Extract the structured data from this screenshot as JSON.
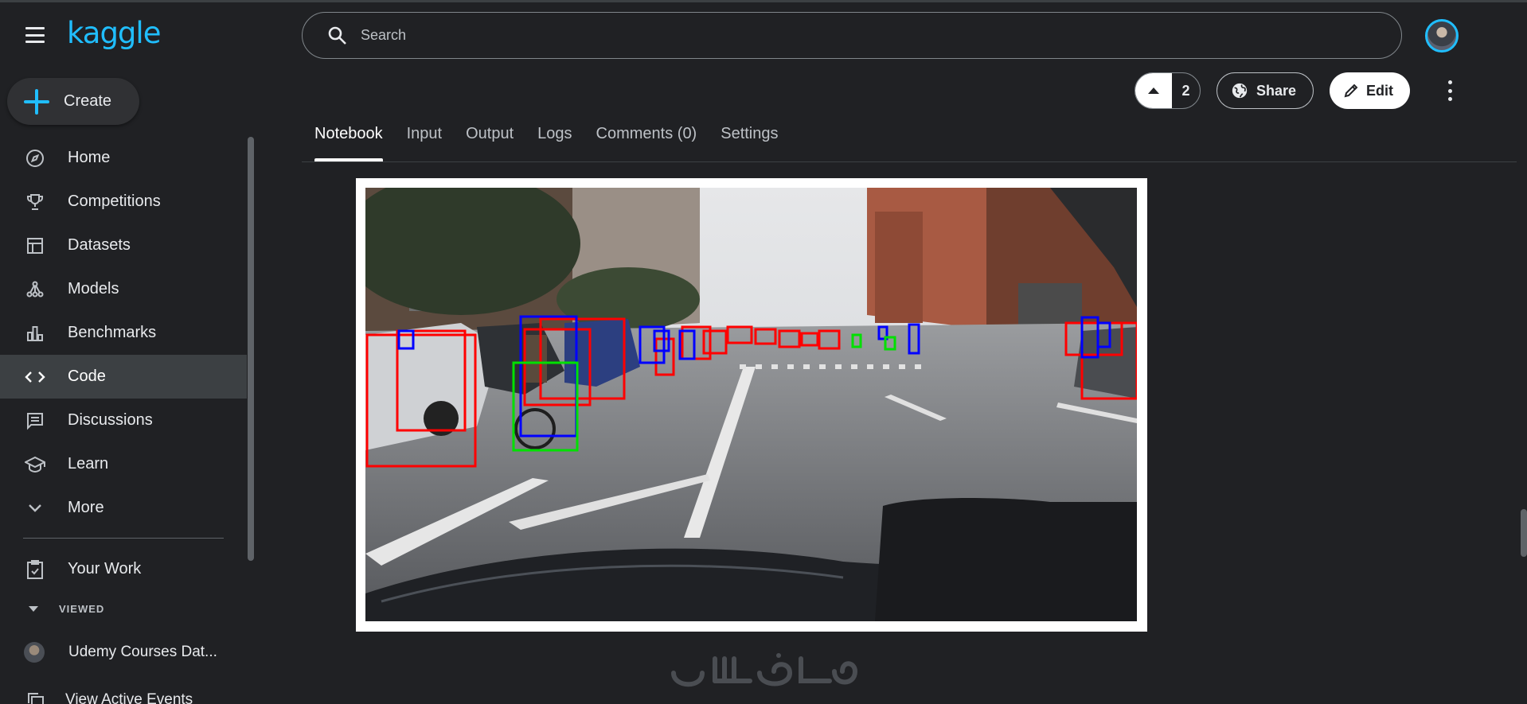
{
  "app": {
    "logo": "kaggle"
  },
  "sidebar": {
    "create_label": "Create",
    "items": [
      {
        "label": "Home",
        "icon": "compass-icon"
      },
      {
        "label": "Competitions",
        "icon": "trophy-icon"
      },
      {
        "label": "Datasets",
        "icon": "table-icon"
      },
      {
        "label": "Models",
        "icon": "models-icon"
      },
      {
        "label": "Benchmarks",
        "icon": "bar-chart-icon"
      },
      {
        "label": "Code",
        "icon": "code-icon",
        "active": true
      },
      {
        "label": "Discussions",
        "icon": "comment-icon"
      },
      {
        "label": "Learn",
        "icon": "school-icon"
      },
      {
        "label": "More",
        "icon": "chevron-down-icon"
      }
    ],
    "your_work": "Your Work",
    "viewed_header": "VIEWED",
    "recent_item": "Udemy Courses Dat...",
    "active_events": "View Active Events"
  },
  "search": {
    "placeholder": "Search"
  },
  "actions": {
    "vote_count": "2",
    "share_label": "Share",
    "edit_label": "Edit"
  },
  "tabs": [
    "Notebook",
    "Input",
    "Output",
    "Logs",
    "Comments (0)",
    "Settings"
  ],
  "active_tab": "Notebook",
  "colors": {
    "accent": "#20beff",
    "background": "#202124",
    "box_red": "#ff0000",
    "box_blue": "#0000ff",
    "box_green": "#00ff00"
  }
}
